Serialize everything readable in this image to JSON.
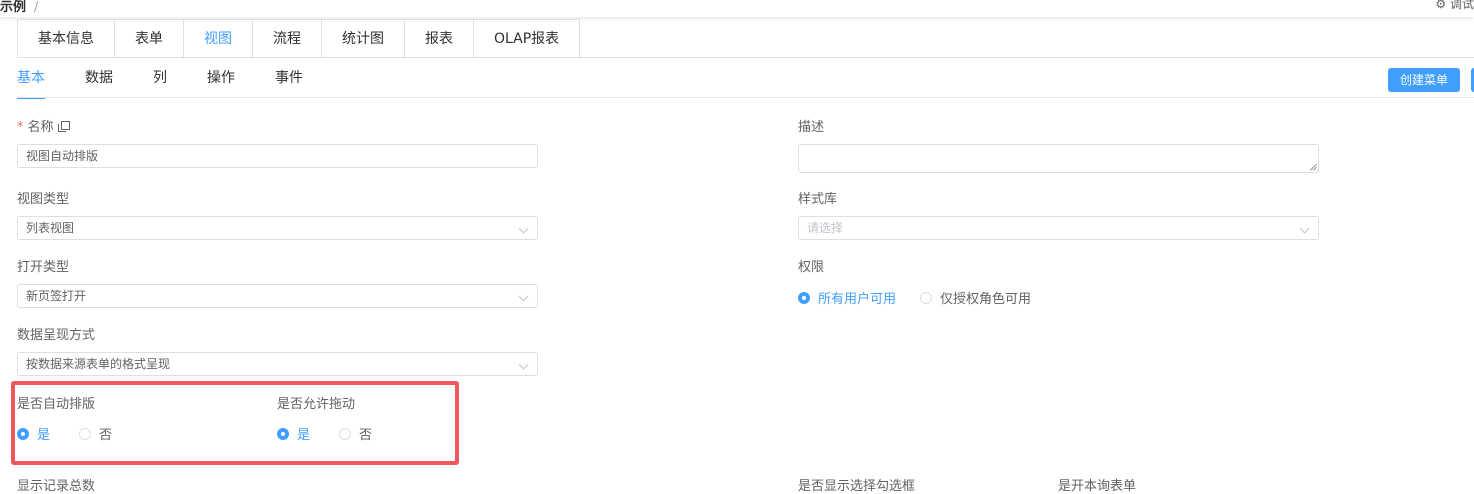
{
  "topbar": {
    "breadcrumb": "示例",
    "separator": "/",
    "right_text": "调试"
  },
  "tabs": [
    {
      "label": "基本信息",
      "active": false
    },
    {
      "label": "表单",
      "active": false
    },
    {
      "label": "视图",
      "active": true
    },
    {
      "label": "流程",
      "active": false
    },
    {
      "label": "统计图",
      "active": false
    },
    {
      "label": "报表",
      "active": false
    },
    {
      "label": "OLAP报表",
      "active": false
    }
  ],
  "subtabs": [
    {
      "label": "基本",
      "active": true
    },
    {
      "label": "数据",
      "active": false
    },
    {
      "label": "列",
      "active": false
    },
    {
      "label": "操作",
      "active": false
    },
    {
      "label": "事件",
      "active": false
    }
  ],
  "toolbar": {
    "create_menu": "创建菜单"
  },
  "form": {
    "name": {
      "required_mark": "*",
      "label": "名称",
      "value": "视图自动排版"
    },
    "description": {
      "label": "描述",
      "value": ""
    },
    "view_type": {
      "label": "视图类型",
      "value": "列表视图"
    },
    "style_lib": {
      "label": "样式库",
      "placeholder": "请选择"
    },
    "open_type": {
      "label": "打开类型",
      "value": "新页签打开"
    },
    "permission": {
      "label": "权限",
      "options": [
        {
          "label": "所有用户可用",
          "selected": true
        },
        {
          "label": "仅授权角色可用",
          "selected": false
        }
      ]
    },
    "data_display": {
      "label": "数据呈现方式",
      "value": "按数据来源表单的格式呈现"
    },
    "auto_layout": {
      "label": "是否自动排版",
      "options": [
        {
          "label": "是",
          "selected": true
        },
        {
          "label": "否",
          "selected": false
        }
      ]
    },
    "allow_drag": {
      "label": "是否允许拖动",
      "options": [
        {
          "label": "是",
          "selected": true
        },
        {
          "label": "否",
          "selected": false
        }
      ]
    },
    "cut_labels": [
      "显示记录总数",
      "是否显示选择勾选框",
      "是开本询表单"
    ]
  },
  "colors": {
    "accent": "#409eff",
    "highlight": "#f0565a"
  }
}
